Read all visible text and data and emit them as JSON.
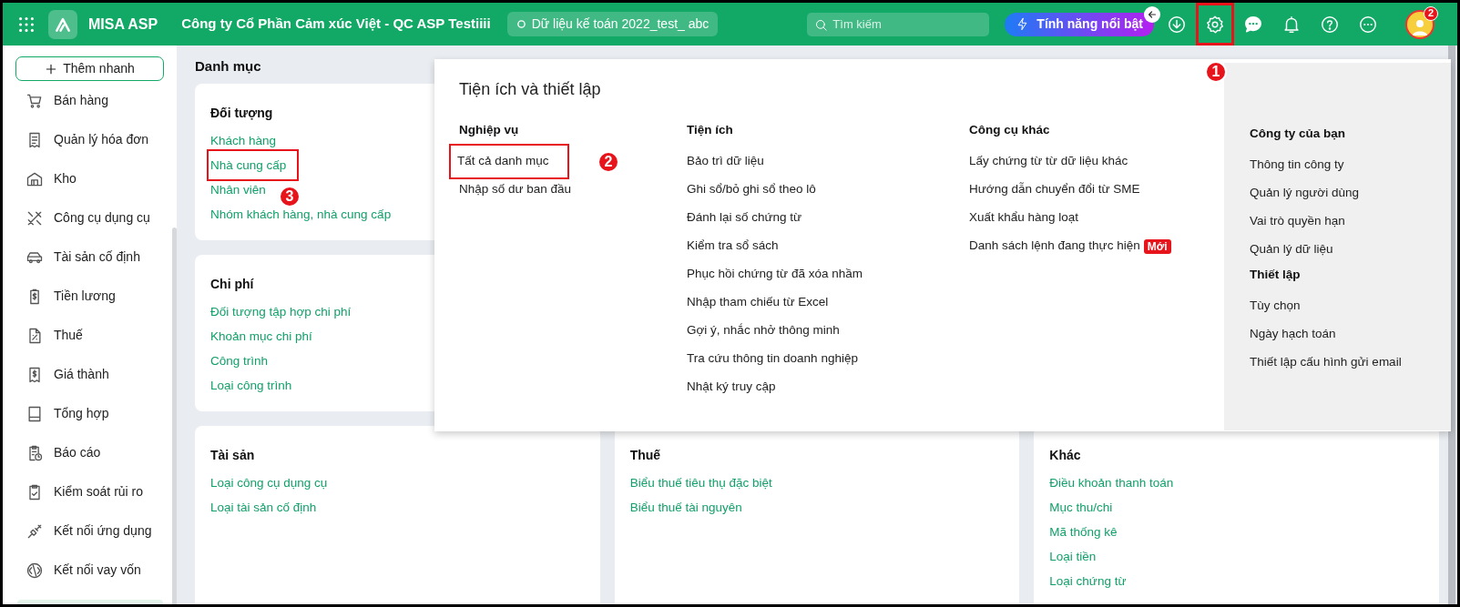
{
  "header": {
    "app_name": "MISA ASP",
    "company": "Công ty Cổ Phần Cảm xúc Việt - QC ASP Testiiii",
    "dataset": "Dữ liệu kế toán 2022_test_ abc",
    "search": {
      "placeholder": "Tìm kiếm"
    },
    "feature_button": "Tính năng nổi bật",
    "settings_callout": "1",
    "avatar_badge": "2"
  },
  "sidebar": {
    "quick_add": "Thêm nhanh",
    "items": [
      {
        "label": "Bán hàng"
      },
      {
        "label": "Quản lý hóa đơn"
      },
      {
        "label": "Kho"
      },
      {
        "label": "Công cụ dụng cụ"
      },
      {
        "label": "Tài sản cố định"
      },
      {
        "label": "Tiền lương"
      },
      {
        "label": "Thuế"
      },
      {
        "label": "Giá thành"
      },
      {
        "label": "Tổng hợp"
      },
      {
        "label": "Báo cáo"
      },
      {
        "label": "Kiểm soát rủi ro"
      },
      {
        "label": "Kết nối ứng dụng"
      },
      {
        "label": "Kết nối vay vốn"
      }
    ]
  },
  "page_title": "Danh mục",
  "card_rows": [
    {
      "cards": [
        {
          "title": "Đối tượng",
          "links": [
            {
              "label": "Khách hàng"
            },
            {
              "label": "Nhà cung cấp",
              "callout": "3"
            },
            {
              "label": "Nhân viên"
            },
            {
              "label": "Nhóm khách hàng, nhà cung cấp"
            }
          ]
        }
      ]
    },
    {
      "cards": [
        {
          "title": "Chi phí",
          "links": [
            {
              "label": "Đối tượng tập hợp chi phí"
            },
            {
              "label": "Khoản mục chi phí"
            },
            {
              "label": "Công trình"
            },
            {
              "label": "Loại công trình"
            }
          ]
        }
      ]
    },
    {
      "cards": [
        {
          "title": "Tài sản",
          "links": [
            {
              "label": "Loại công cụ dụng cụ"
            },
            {
              "label": "Loại tài sản cố định"
            }
          ]
        },
        {
          "title": "Thuế",
          "links": [
            {
              "label": "Biểu thuế tiêu thụ đặc biệt"
            },
            {
              "label": "Biểu thuế tài nguyên"
            }
          ]
        },
        {
          "title": "Khác",
          "links": [
            {
              "label": "Điều khoản thanh toán"
            },
            {
              "label": "Mục thu/chi"
            },
            {
              "label": "Mã thống kê"
            },
            {
              "label": "Loại tiền"
            },
            {
              "label": "Loại chứng từ"
            }
          ]
        }
      ]
    }
  ],
  "popup": {
    "title": "Tiện ích và thiết lập",
    "columns": [
      {
        "groups": [
          {
            "title": "Nghiệp vụ",
            "items": [
              {
                "label": "Tất cả danh mục",
                "callout": "2"
              },
              {
                "label": "Nhập số dư ban đầu"
              }
            ]
          }
        ]
      },
      {
        "groups": [
          {
            "title": "Tiện ích",
            "items": [
              {
                "label": "Bảo trì dữ liệu"
              },
              {
                "label": "Ghi sổ/bỏ ghi sổ theo lô"
              },
              {
                "label": "Đánh lại số chứng từ"
              },
              {
                "label": "Kiểm tra sổ sách"
              },
              {
                "label": "Phục hồi chứng từ đã xóa nhầm"
              },
              {
                "label": "Nhập tham chiếu từ Excel"
              },
              {
                "label": "Gợi ý, nhắc nhở thông minh"
              },
              {
                "label": "Tra cứu thông tin doanh nghiệp"
              },
              {
                "label": "Nhật ký truy cập"
              }
            ]
          }
        ]
      },
      {
        "groups": [
          {
            "title": "Công cụ khác",
            "items": [
              {
                "label": "Lấy chứng từ từ dữ liệu khác"
              },
              {
                "label": "Hướng dẫn chuyển đổi từ SME"
              },
              {
                "label": "Xuất khẩu hàng loạt"
              },
              {
                "label": "Danh sách lệnh đang thực hiện",
                "badge": "Mới"
              }
            ]
          }
        ]
      }
    ],
    "side_panel": {
      "groups": [
        {
          "title": "Công ty của bạn",
          "items": [
            {
              "label": "Thông tin công ty"
            },
            {
              "label": "Quản lý người dùng"
            },
            {
              "label": "Vai trò quyền hạn"
            },
            {
              "label": "Quản lý dữ liệu"
            }
          ]
        },
        {
          "title": "Thiết lập",
          "items": [
            {
              "label": "Tùy chọn"
            },
            {
              "label": "Ngày hạch toán"
            },
            {
              "label": "Thiết lập cấu hình gửi email"
            }
          ]
        }
      ]
    }
  }
}
